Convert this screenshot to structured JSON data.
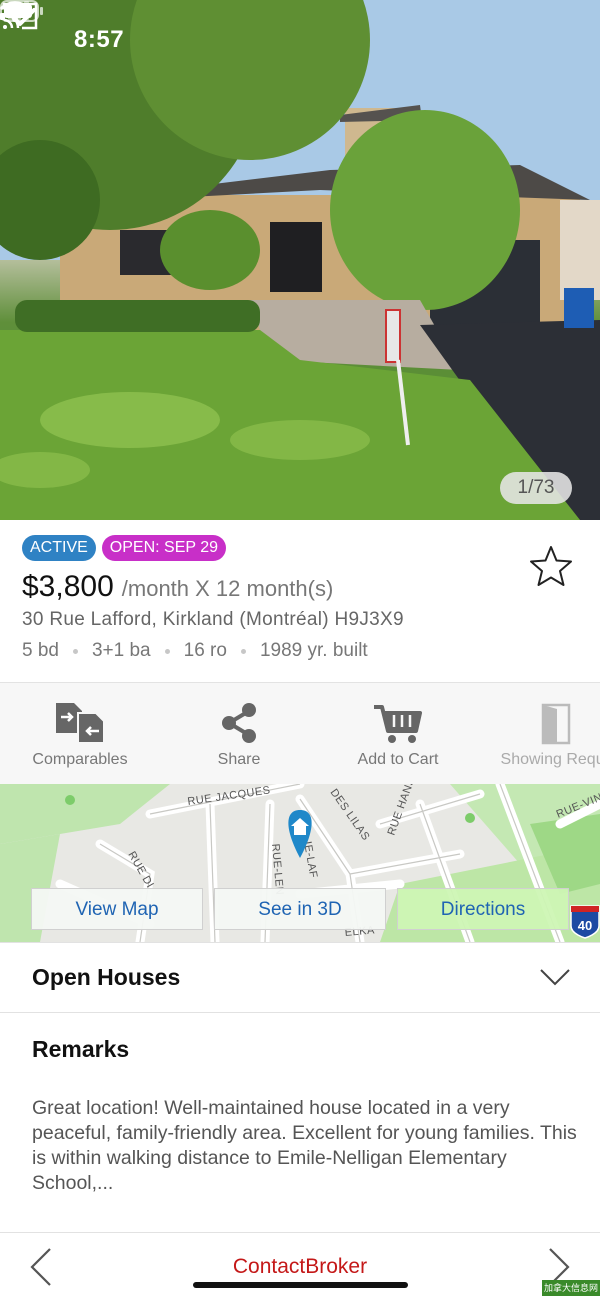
{
  "status_bar": {
    "time": "8:57"
  },
  "gallery": {
    "counter": "1/73"
  },
  "listing": {
    "status_badge": "ACTIVE",
    "open_badge": "OPEN: SEP 29",
    "price": "$3,800",
    "price_term": "/month X 12 month(s)",
    "address": "30 Rue Lafford, Kirkland (Montréal)  H9J3X9",
    "facts": [
      "5 bd",
      "3+1 ba",
      "16 ro",
      "1989 yr. built"
    ]
  },
  "actions": [
    {
      "label": "Comparables",
      "icon": "comparables-icon"
    },
    {
      "label": "Share",
      "icon": "share-icon"
    },
    {
      "label": "Add to Cart",
      "icon": "cart-icon"
    },
    {
      "label": "Showing Reque",
      "icon": "door-icon"
    }
  ],
  "map": {
    "streets": [
      "RUE JACQUES",
      "DES LILAS",
      "RUE HANS",
      "RUE-VIN",
      "RUE DI",
      "RUE-LEN",
      "IE-LAF",
      "ELKA"
    ],
    "highway_shield": "40",
    "buttons": {
      "view_map": "View Map",
      "see_3d": "See in 3D",
      "directions": "Directions"
    }
  },
  "sections": {
    "open_houses": "Open Houses",
    "remarks": "Remarks",
    "remarks_text": " Great location! Well-maintained house located in a very peaceful, family-friendly area. Excellent for young families. This  is within walking distance to Emile-Nelligan Elementary School,..."
  },
  "bottom_nav": {
    "contact": "ContactBroker"
  },
  "watermark": "加拿大信息网",
  "colors": {
    "active": "#2f82c4",
    "open": "#c82fc8",
    "link": "#1f64b3",
    "contact": "#c41818"
  }
}
